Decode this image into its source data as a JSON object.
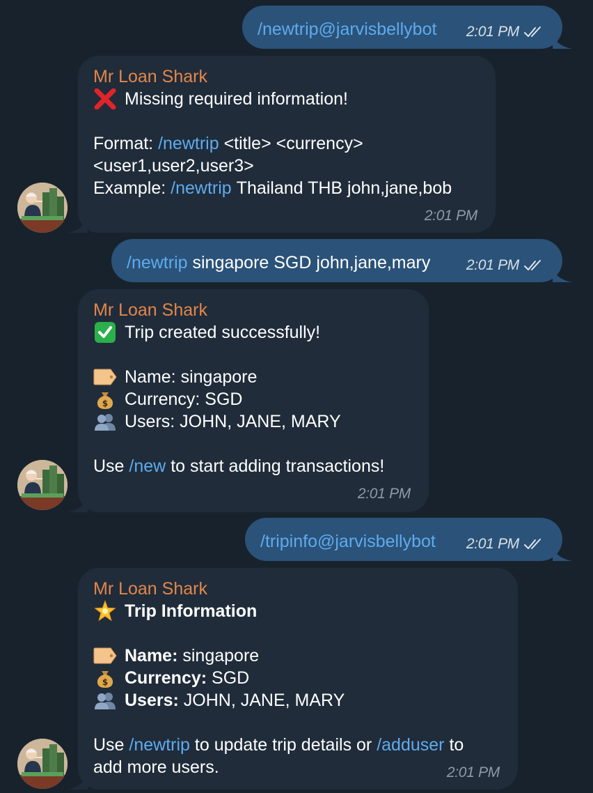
{
  "messages": [
    {
      "type": "outgoing",
      "command": "/newtrip@jarvisbellybot",
      "time": "2:01 PM"
    },
    {
      "type": "incoming",
      "sender": "Mr Loan Shark",
      "heading": "Missing required information!",
      "heading_icon": "cross-mark-icon",
      "format_label": "Format:",
      "format_command": "/newtrip",
      "format_rest": "<title> <currency>",
      "format_line2": "<user1,user2,user3>",
      "example_label": "Example:",
      "example_command": "/newtrip",
      "example_rest": "Thailand THB john,jane,bob",
      "time": "2:01 PM"
    },
    {
      "type": "outgoing",
      "command": "/newtrip",
      "args": "singapore SGD john,jane,mary",
      "time": "2:01 PM"
    },
    {
      "type": "incoming",
      "sender": "Mr Loan Shark",
      "heading": "Trip created successfully!",
      "heading_icon": "check-mark-icon",
      "name_line": "Name: singapore",
      "currency_line": "Currency: SGD",
      "users_line": "Users: JOHN, JANE, MARY",
      "use_prefix": "Use",
      "use_command": "/new",
      "use_suffix": "to start adding transactions!",
      "time": "2:01 PM"
    },
    {
      "type": "outgoing",
      "command": "/tripinfo@jarvisbellybot",
      "time": "2:01 PM"
    },
    {
      "type": "incoming",
      "sender": "Mr Loan Shark",
      "heading": "Trip Information",
      "heading_icon": "glowing-star-icon",
      "name_label": "Name:",
      "name_value": "singapore",
      "currency_label": "Currency:",
      "currency_value": "SGD",
      "users_label": "Users:",
      "users_value": "JOHN, JANE, MARY",
      "use_prefix": "Use",
      "use_command": "/newtrip",
      "use_mid": "to update trip details or",
      "use_command2": "/adduser",
      "use_suffix": "to",
      "use_line2": "add more users.",
      "time": "2:01 PM"
    }
  ],
  "icons": {
    "name": "label-tag-icon",
    "currency": "money-bag-icon",
    "users": "people-silhouette-icon",
    "read_status": "double-check-icon"
  },
  "colors": {
    "background": "#18222d",
    "outgoing_bubble": "#2b5278",
    "incoming_bubble": "#202c3a",
    "sender_name": "#e3874a",
    "link": "#5eabef"
  }
}
